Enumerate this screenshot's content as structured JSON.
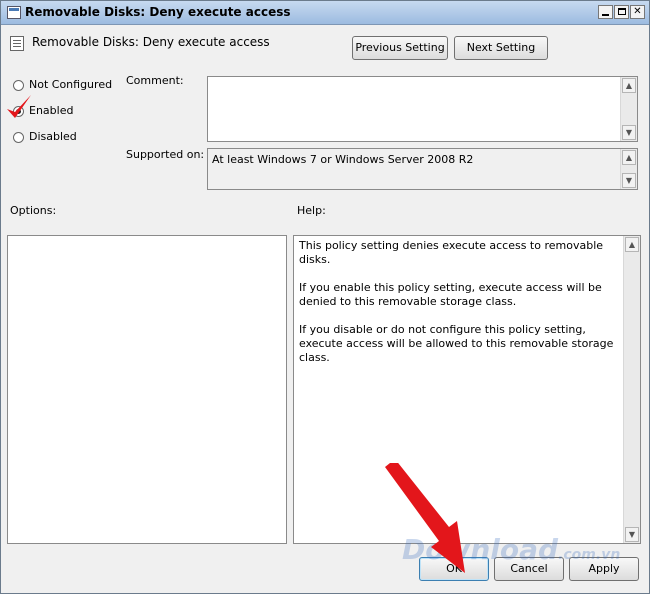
{
  "window": {
    "title": "Removable Disks: Deny execute access",
    "setting_title": "Removable Disks: Deny execute access"
  },
  "nav": {
    "previous": "Previous Setting",
    "next": "Next Setting"
  },
  "state": {
    "options": [
      {
        "label": "Not Configured",
        "selected": false
      },
      {
        "label": "Enabled",
        "selected": true
      },
      {
        "label": "Disabled",
        "selected": false
      }
    ]
  },
  "labels": {
    "comment": "Comment:",
    "supported_on": "Supported on:",
    "options": "Options:",
    "help": "Help:"
  },
  "fields": {
    "comment_value": "",
    "supported_value": "At least Windows 7 or Windows Server 2008 R2"
  },
  "help_text": [
    "This policy setting denies execute access to removable disks.",
    "If you enable this policy setting, execute access will be denied to this removable storage class.",
    "If you disable or do not configure this policy setting, execute access will be allowed to this removable storage class."
  ],
  "footer": {
    "ok": "OK",
    "cancel": "Cancel",
    "apply": "Apply"
  },
  "watermark": {
    "main": "Download",
    "suffix": ".com.vn"
  },
  "colors": {
    "annotation_red": "#e3161b",
    "titlebar": "#b8d0ec"
  }
}
